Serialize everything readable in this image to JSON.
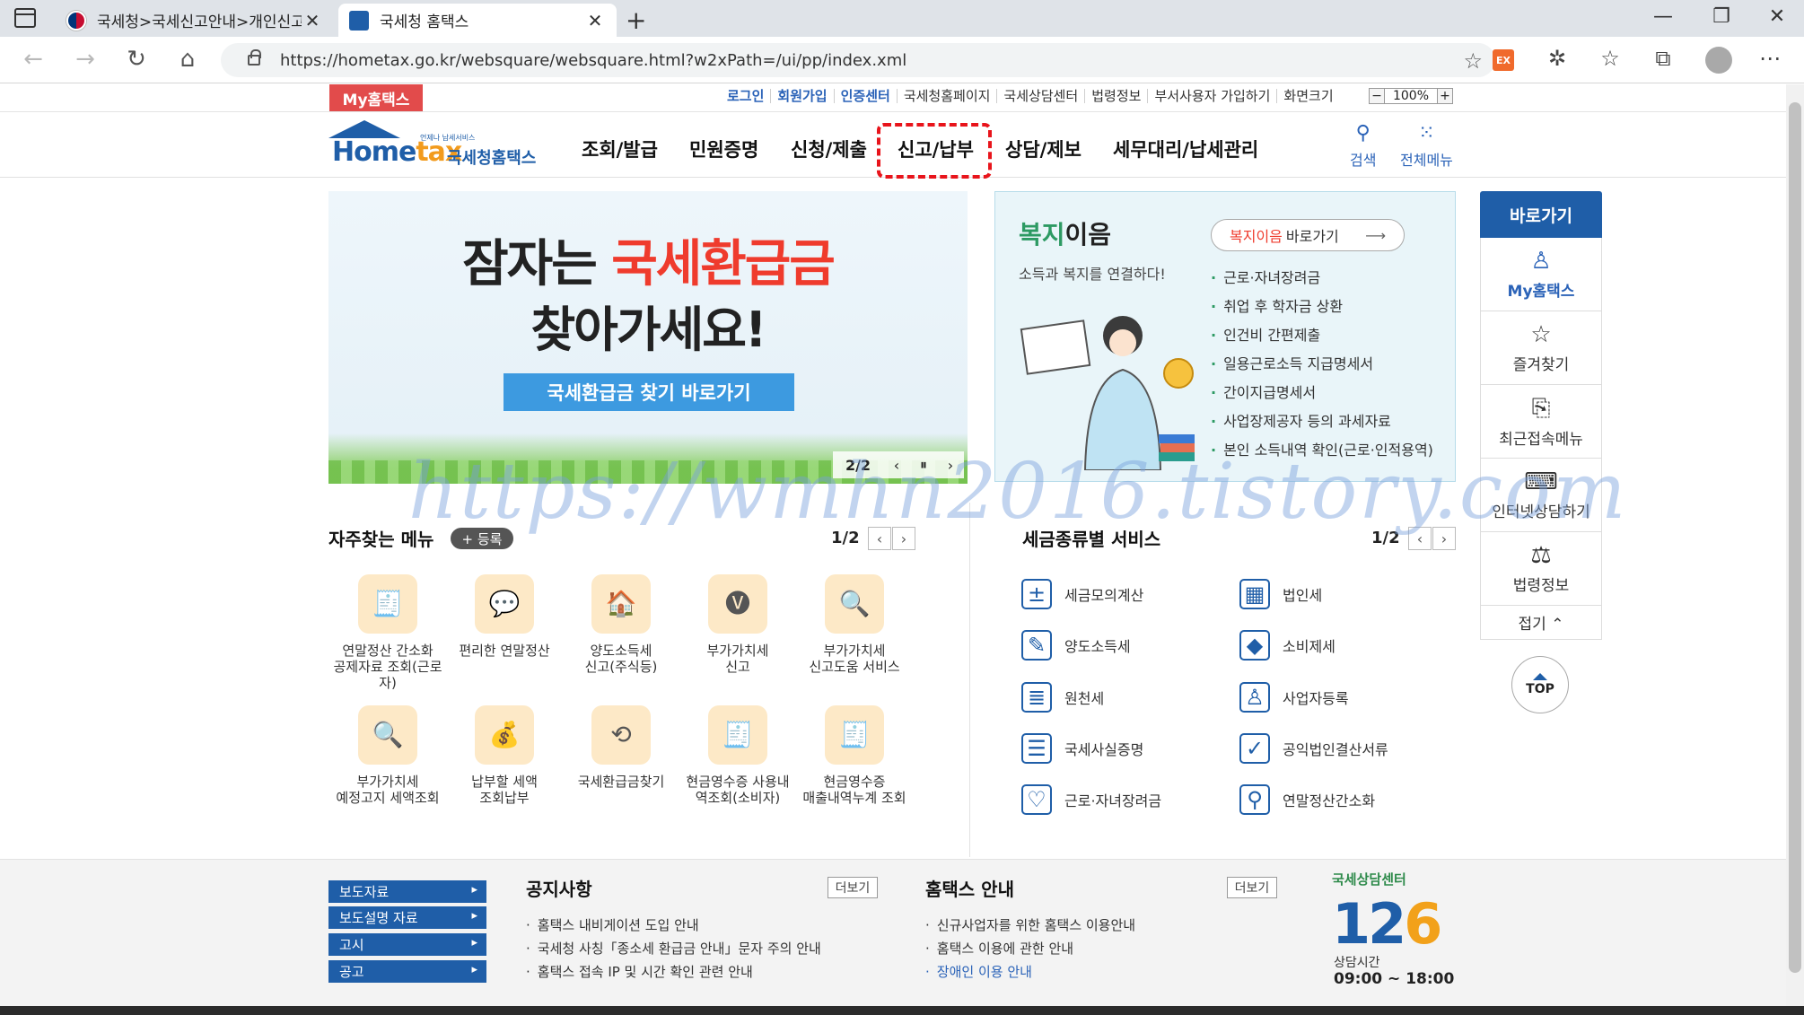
{
  "browser": {
    "tabs": [
      {
        "title": "국세청>국세신고안내>개인신고",
        "active": false
      },
      {
        "title": "국세청 홈택스",
        "active": true
      }
    ],
    "url": "https://hometax.go.kr/websquare/websquare.html?w2xPath=/ui/pp/index.xml",
    "ext_label": "EX"
  },
  "util": {
    "my_label": "My홈택스",
    "links": [
      "로그인",
      "회원가입",
      "인증센터",
      "국세청홈페이지",
      "국세상담센터",
      "법령정보",
      "부서사용자 가입하기",
      "화면크기"
    ],
    "zoom": "100%",
    "zoom_minus": "−",
    "zoom_plus": "+"
  },
  "header": {
    "logo_small": "언제나 납세서비스",
    "logo_word_a": "Home",
    "logo_word_b": "tax",
    "logo_kor": "국세청홈택스",
    "menu": [
      "조회/발급",
      "민원증명",
      "신청/제출",
      "신고/납부",
      "상담/제보",
      "세무대리/납세관리"
    ],
    "search_label": "검색",
    "allmenu_label": "전체메뉴"
  },
  "banner": {
    "line1_prefix": "잠자는 ",
    "line1_highlight": "국세환급금",
    "line2": "찾아가세요!",
    "cta": "국세환급금 찾기 바로가기",
    "page": "2/2",
    "prev": "‹",
    "pause": "⏸",
    "next": "›"
  },
  "welfare": {
    "title_a": "복지",
    "title_b": "이음",
    "subtitle": "소득과 복지를 연결하다!",
    "btn_a": "복지이음",
    "btn_b": "바로가기",
    "items": [
      "근로·자녀장려금",
      "취업 후 학자금 상환",
      "인건비 간편제출",
      "일용근로소득 지급명세서",
      "간이지급명세서",
      "사업장제공자 등의 과세자료",
      "본인 소득내역 확인(근로·인적용역)"
    ]
  },
  "quick": {
    "header": "바로가기",
    "items": [
      {
        "label": "My홈택스",
        "icon": "person-icon"
      },
      {
        "label": "즐겨찾기",
        "icon": "star-icon"
      },
      {
        "label": "최근접속메뉴",
        "icon": "recent-icon"
      },
      {
        "label": "인터넷상담하기",
        "icon": "laptop-icon"
      },
      {
        "label": "법령정보",
        "icon": "gavel-icon"
      }
    ],
    "fold": "접기 ⌃",
    "top": "TOP"
  },
  "frequent": {
    "title": "자주찾는 메뉴",
    "register": "+ 등록",
    "page": "1/2",
    "items": [
      {
        "lines": [
          "연말정산 간소화",
          "공제자료 조회(근로",
          "자)"
        ]
      },
      {
        "lines": [
          "편리한 연말정산"
        ]
      },
      {
        "lines": [
          "양도소득세",
          "신고(주식등)"
        ]
      },
      {
        "lines": [
          "부가가치세",
          "신고"
        ]
      },
      {
        "lines": [
          "부가가치세",
          "신고도움 서비스"
        ]
      },
      {
        "lines": [
          "부가가치세",
          "예정고지 세액조회"
        ]
      },
      {
        "lines": [
          "납부할 세액",
          "조회납부"
        ]
      },
      {
        "lines": [
          "국세환급금찾기"
        ]
      },
      {
        "lines": [
          "현금영수증 사용내",
          "역조회(소비자)"
        ]
      },
      {
        "lines": [
          "현금영수증",
          "매출내역누계 조회"
        ]
      }
    ]
  },
  "taxservice": {
    "title": "세금종류별 서비스",
    "page": "1/2",
    "items": [
      "세금모의계산",
      "법인세",
      "양도소득세",
      "소비제세",
      "원천세",
      "사업자등록",
      "국세사실증명",
      "공익법인결산서류",
      "근로·자녀장려금",
      "연말정산간소화"
    ]
  },
  "footer": {
    "buttons": [
      "보도자료",
      "보도설명 자료",
      "고시",
      "공고"
    ],
    "notice_title": "공지사항",
    "notice_more": "더보기",
    "notices": [
      "홈택스 내비게이션 도입 안내",
      "국세청 사칭「종소세 환급금 안내」문자 주의 안내",
      "홈택스 접속 IP 및 시간 확인 관련 안내"
    ],
    "guide_title": "홈택스 안내",
    "guide_more": "더보기",
    "guides": [
      "신규사업자를 위한 홈택스 이용안내",
      "홈택스 이용에 관한 안내",
      "장애인 이용 안내"
    ],
    "call_top": "국세상담센터",
    "call_num_a": "12",
    "call_num_b": "6",
    "call_hours_label": "상담시간",
    "call_hours": "09:00 ~ 18:00"
  },
  "watermark": "https://wmhn2016.tistory.com"
}
